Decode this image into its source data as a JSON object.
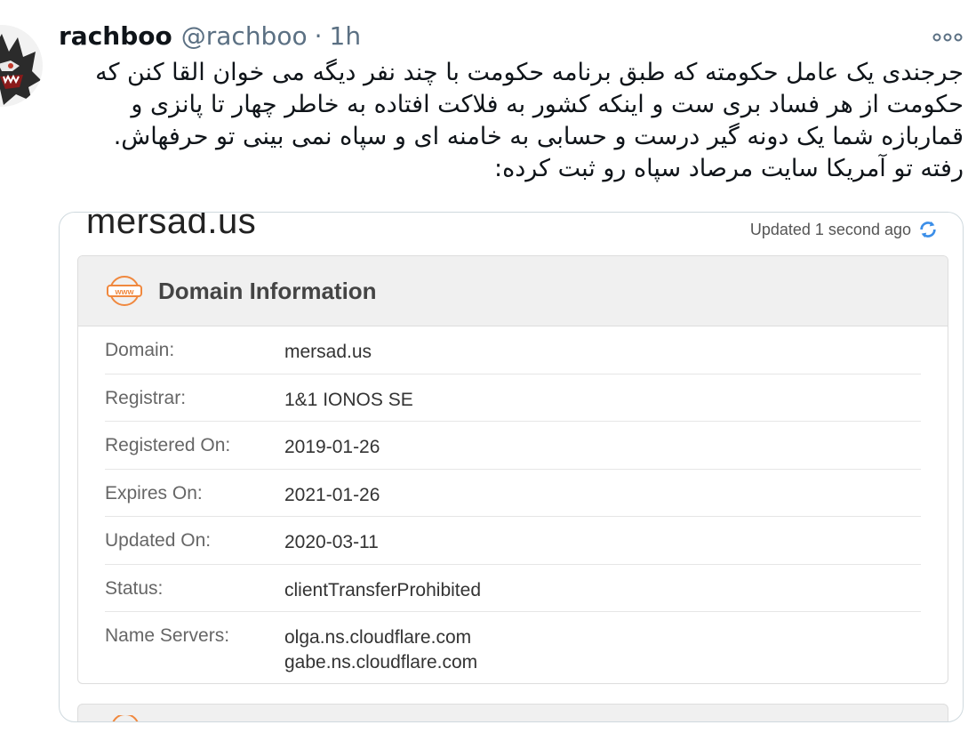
{
  "tweet": {
    "author_name": "rachboo",
    "author_handle": "@rachboo",
    "separator": "·",
    "time": "1h",
    "text": "جرجندی یک عامل حکومته که طبق برنامه حکومت با چند نفر دیگه می خوان القا کنن که حکومت از هر فساد بری ست و اینکه کشور به فلاکت افتاده به خاطر چهار تا پانزی و قماربازه شما یک دونه گیر درست و حسابی به خامنه ای و سپاه نمی بینی تو حرفهاش.\nرفته تو آمریکا سایت مرصاد سپاه رو ثبت کرده:",
    "avatar_icon": "wolf-avatar-icon",
    "more_icon": "more-options-icon"
  },
  "card": {
    "site_title": "mersad.us",
    "updated_text": "Updated 1 second ago",
    "refresh_icon": "refresh-icon",
    "section_title": "Domain Information",
    "section_icon": "www-icon",
    "rows": [
      {
        "label": "Domain:",
        "value": "mersad.us"
      },
      {
        "label": "Registrar:",
        "value": "1&1 IONOS SE"
      },
      {
        "label": "Registered On:",
        "value": "2019-01-26"
      },
      {
        "label": "Expires On:",
        "value": "2021-01-26"
      },
      {
        "label": "Updated On:",
        "value": "2020-03-11"
      },
      {
        "label": "Status:",
        "value": "clientTransferProhibited"
      },
      {
        "label": "Name Servers:",
        "value": "olga.ns.cloudflare.com",
        "value2": "gabe.ns.cloudflare.com"
      }
    ]
  },
  "colors": {
    "text": "#0f1419",
    "muted": "#5b7083",
    "accent_orange": "#f0883e",
    "accent_blue": "#3b8ee8"
  }
}
